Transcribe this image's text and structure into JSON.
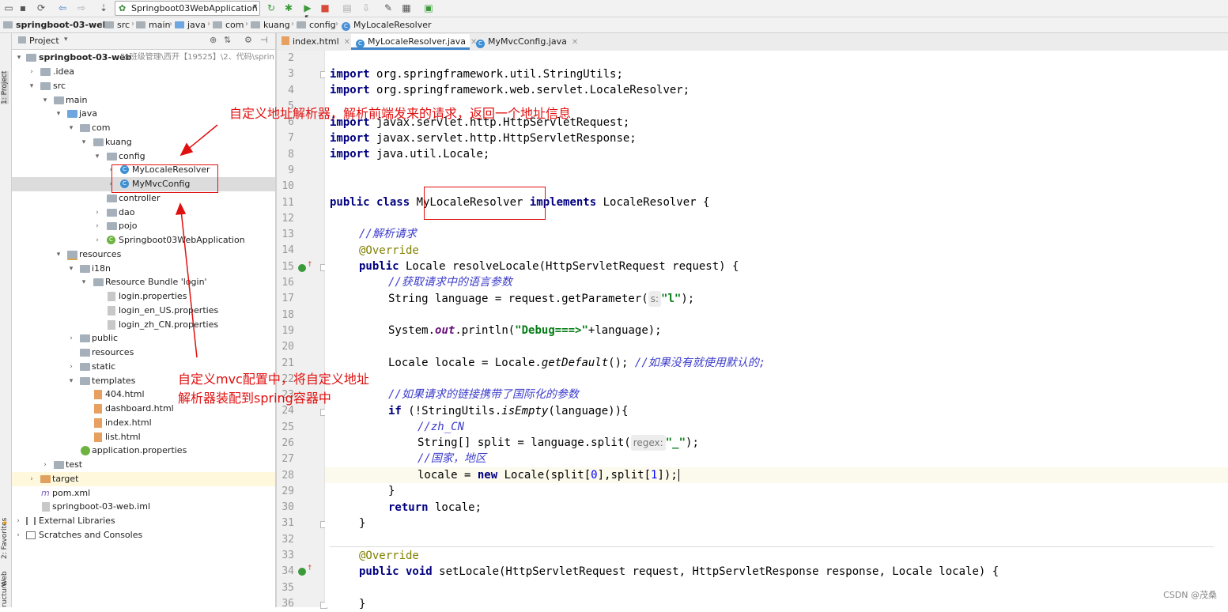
{
  "toolbar": {
    "run_config": "Springboot03WebApplication"
  },
  "breadcrumb": [
    "springboot-03-web",
    "src",
    "main",
    "java",
    "com",
    "kuang",
    "config",
    "MyLocaleResolver"
  ],
  "left_stripe": {
    "project": "1: Project",
    "favorites": "2: Favorites",
    "web": "Web",
    "structure": "ructure"
  },
  "project_panel": {
    "title": "Project",
    "root": "springboot-03-web",
    "root_path": "F:\\班级管理\\西开【19525】\\2、代码\\sprin",
    "items": [
      ".idea",
      "src",
      "main",
      "java",
      "com",
      "kuang",
      "config",
      "MyLocaleResolver",
      "MyMvcConfig",
      "controller",
      "dao",
      "pojo",
      "Springboot03WebApplication",
      "resources",
      "i18n",
      "Resource Bundle 'login'",
      "login.properties",
      "login_en_US.properties",
      "login_zh_CN.properties",
      "public",
      "resources",
      "static",
      "templates",
      "404.html",
      "dashboard.html",
      "index.html",
      "list.html",
      "application.properties",
      "test",
      "target",
      "pom.xml",
      "springboot-03-web.iml",
      "External Libraries",
      "Scratches and Consoles"
    ]
  },
  "tabs": [
    {
      "label": "index.html"
    },
    {
      "label": "MyLocaleResolver.java"
    },
    {
      "label": "MyMvcConfig.java"
    }
  ],
  "editor": {
    "line_numbers": [
      "2",
      "3",
      "4",
      "5",
      "6",
      "7",
      "8",
      "9",
      "10",
      "11",
      "12",
      "13",
      "14",
      "15",
      "16",
      "17",
      "18",
      "19",
      "20",
      "21",
      "22",
      "23",
      "24",
      "25",
      "26",
      "27",
      "28",
      "29",
      "30",
      "31",
      "32",
      "33",
      "34",
      "35",
      "36"
    ],
    "lines": {
      "l3_kw": "import",
      "l3_rest": " org.springframework.util.StringUtils;",
      "l4_kw": "import",
      "l4_rest": " org.springframework.web.servlet.LocaleResolver;",
      "l6_kw": "import",
      "l6_rest": " javax.servlet.http.HttpServletRequest;",
      "l7_kw": "import",
      "l7_rest": " javax.servlet.http.HttpServletResponse;",
      "l8_kw": "import",
      "l8_rest": " java.util.Locale;",
      "l11_kw": "public class ",
      "l11_name": "MyLocaleResolver",
      "l11_kw2": " implements",
      "l11_rest": " LocaleResolver {",
      "l13": "//解析请求",
      "l14": "@Override",
      "l15_kw": "public",
      "l15_rest": " Locale resolveLocale(HttpServletRequest request) {",
      "l16": "//获取请求中的语言参数",
      "l17_a": "String language = request.getParameter(",
      "l17_hint": "s:",
      "l17_str": "\"l\"",
      "l17_b": ");",
      "l19_a": "System.",
      "l19_it": "out",
      "l19_b": ".println(",
      "l19_str": "\"Debug===>\"",
      "l19_c": "+language);",
      "l21_a": "Locale locale = Locale.",
      "l21_it": "getDefault",
      "l21_b": "(); ",
      "l21_cm": "//如果没有就使用默认的;",
      "l23": "//如果请求的链接携带了国际化的参数",
      "l24_kw": "if",
      "l24_a": " (!StringUtils.",
      "l24_it": "isEmpty",
      "l24_b": "(language)){",
      "l25": "//zh_CN",
      "l26_a": "String[] split = language.split(",
      "l26_hint": "regex:",
      "l26_str": "\"_\"",
      "l26_b": ");",
      "l27": "//国家，地区",
      "l28_a": "locale = ",
      "l28_kw": "new",
      "l28_b": " Locale(split[",
      "l28_n0": "0",
      "l28_c": "],split[",
      "l28_n1": "1",
      "l28_d": "]);",
      "l29": "}",
      "l30_kw": "return",
      "l30_rest": " locale;",
      "l31": "}",
      "l33": "@Override",
      "l34_kw": "public void",
      "l34_rest": " setLocale(HttpServletRequest request, HttpServletResponse response, Locale locale) {",
      "l36": "}"
    }
  },
  "annotations": {
    "top": "自定义地址解析器，解析前端发来的请求，返回一个地址信息",
    "bottom_line1": "自定义mvc配置中，将自定义地址",
    "bottom_line2": "解析器装配到spring容器中"
  },
  "watermark": "CSDN @茂桑",
  "colors": {
    "annotation": "#e01010",
    "keyword": "#000080",
    "comment": "#3d3dcc",
    "annotation_code": "#808000",
    "string": "#067d17",
    "selection": "#dcdcdc"
  }
}
